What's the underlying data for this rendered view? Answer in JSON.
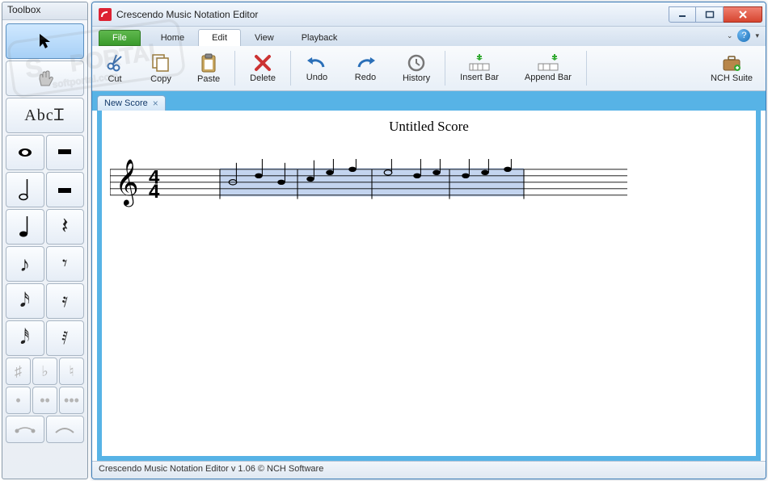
{
  "toolbox": {
    "title": "Toolbox"
  },
  "window": {
    "title": "Crescendo Music Notation Editor"
  },
  "menu": {
    "file": "File",
    "tabs": [
      {
        "label": "Home"
      },
      {
        "label": "Edit"
      },
      {
        "label": "View"
      },
      {
        "label": "Playback"
      }
    ],
    "active_index": 1
  },
  "ribbon": {
    "items": [
      {
        "label": "Cut"
      },
      {
        "label": "Copy"
      },
      {
        "label": "Paste"
      },
      {
        "label": "Delete"
      },
      {
        "label": "Undo"
      },
      {
        "label": "Redo"
      },
      {
        "label": "History"
      },
      {
        "label": "Insert Bar"
      },
      {
        "label": "Append Bar"
      },
      {
        "label": "NCH Suite"
      }
    ]
  },
  "doc": {
    "tab_label": "New Score",
    "score_title": "Untitled Score"
  },
  "status": "Crescendo Music Notation Editor v 1.06 © NCH Software",
  "colors": {
    "accent": "#57b3e6",
    "file_btn": "#3a9a2c"
  }
}
